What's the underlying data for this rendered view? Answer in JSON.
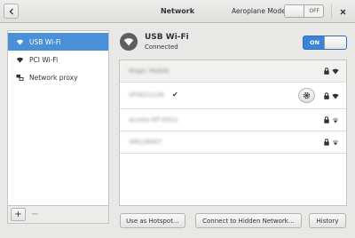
{
  "header": {
    "title": "Network",
    "airplane_label": "Aeroplane Mode",
    "airplane_state": "OFF"
  },
  "sidebar": {
    "items": [
      {
        "label": "USB Wi-Fi",
        "icon": "wifi-icon",
        "selected": true
      },
      {
        "label": "PCI Wi-Fi",
        "icon": "wifi-icon",
        "selected": false
      },
      {
        "label": "Network proxy",
        "icon": "proxy-icon",
        "selected": false
      }
    ],
    "add_label": "+",
    "remove_label": "−"
  },
  "device": {
    "name": "USB Wi-Fi",
    "status": "Connected",
    "switch_state": "ON"
  },
  "networks": [
    {
      "name": "Magic Mobile",
      "connected": false,
      "secured": true,
      "settings": false
    },
    {
      "name": "VF0021134",
      "connected": true,
      "secured": true,
      "settings": true
    },
    {
      "name": "access-NT-0012",
      "connected": false,
      "secured": true,
      "settings": false
    },
    {
      "name": "VM128007",
      "connected": false,
      "secured": true,
      "settings": false
    }
  ],
  "buttons": {
    "hotspot": "Use as Hotspot…",
    "hidden": "Connect to Hidden Network…",
    "history": "History"
  },
  "colors": {
    "accent": "#4a90d9",
    "switch_on": "#3d84d6"
  }
}
